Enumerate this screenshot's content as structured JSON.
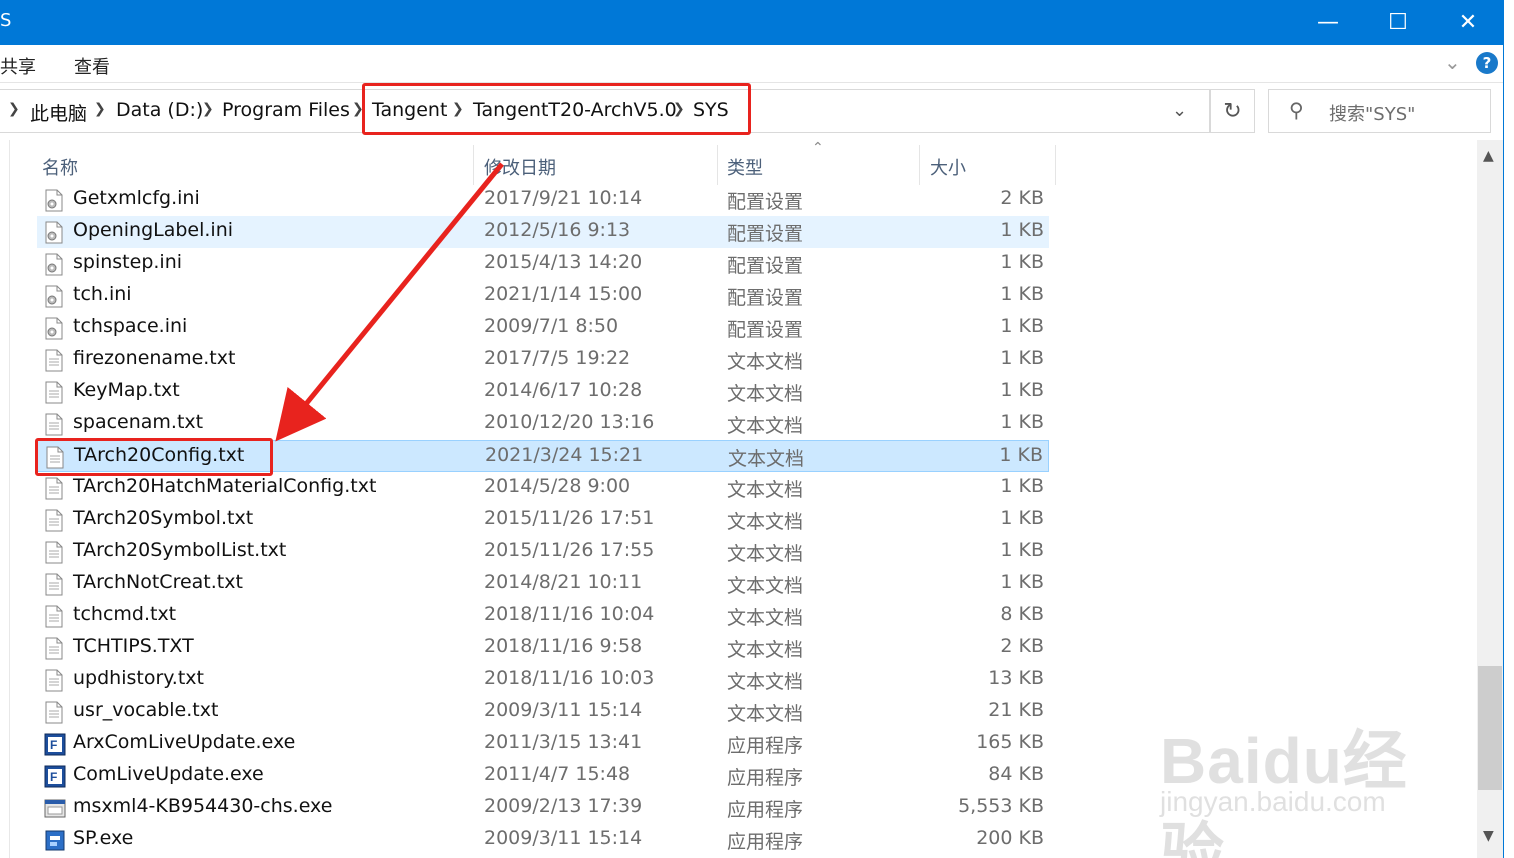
{
  "window": {
    "title_fragment": "S",
    "minimize_glyph": "—",
    "maximize_glyph": "☐",
    "close_glyph": "✕"
  },
  "ribbon": {
    "tabs": [
      "共享",
      "查看"
    ],
    "help_glyph": "?"
  },
  "address": {
    "crumbs": [
      "此电脑",
      "Data (D:)",
      "Program Files",
      "Tangent",
      "TangentT20-ArchV5.0",
      "SYS"
    ],
    "search_placeholder": "搜索\"SYS\""
  },
  "columns": [
    "名称",
    "修改日期",
    "类型",
    "大小"
  ],
  "files": [
    {
      "name": "Getxmlcfg.ini",
      "date": "2017/9/21 10:14",
      "type": "配置设置",
      "size": "2 KB",
      "icon": "ini-file-icon"
    },
    {
      "name": "OpeningLabel.ini",
      "date": "2012/5/16 9:13",
      "type": "配置设置",
      "size": "1 KB",
      "icon": "ini-file-icon"
    },
    {
      "name": "spinstep.ini",
      "date": "2015/4/13 14:20",
      "type": "配置设置",
      "size": "1 KB",
      "icon": "ini-file-icon"
    },
    {
      "name": "tch.ini",
      "date": "2021/1/14 15:00",
      "type": "配置设置",
      "size": "1 KB",
      "icon": "ini-file-icon"
    },
    {
      "name": "tchspace.ini",
      "date": "2009/7/1 8:50",
      "type": "配置设置",
      "size": "1 KB",
      "icon": "ini-file-icon"
    },
    {
      "name": "firezonename.txt",
      "date": "2017/7/5 19:22",
      "type": "文本文档",
      "size": "1 KB",
      "icon": "txt-file-icon"
    },
    {
      "name": "KeyMap.txt",
      "date": "2014/6/17 10:28",
      "type": "文本文档",
      "size": "1 KB",
      "icon": "txt-file-icon"
    },
    {
      "name": "spacenam.txt",
      "date": "2010/12/20 13:16",
      "type": "文本文档",
      "size": "1 KB",
      "icon": "txt-file-icon"
    },
    {
      "name": "TArch20Config.txt",
      "date": "2021/3/24 15:21",
      "type": "文本文档",
      "size": "1 KB",
      "icon": "txt-file-icon"
    },
    {
      "name": "TArch20HatchMaterialConfig.txt",
      "date": "2014/5/28 9:00",
      "type": "文本文档",
      "size": "1 KB",
      "icon": "txt-file-icon"
    },
    {
      "name": "TArch20Symbol.txt",
      "date": "2015/11/26 17:51",
      "type": "文本文档",
      "size": "1 KB",
      "icon": "txt-file-icon"
    },
    {
      "name": "TArch20SymbolList.txt",
      "date": "2015/11/26 17:55",
      "type": "文本文档",
      "size": "1 KB",
      "icon": "txt-file-icon"
    },
    {
      "name": "TArchNotCreat.txt",
      "date": "2014/8/21 10:11",
      "type": "文本文档",
      "size": "1 KB",
      "icon": "txt-file-icon"
    },
    {
      "name": "tchcmd.txt",
      "date": "2018/11/16 10:04",
      "type": "文本文档",
      "size": "8 KB",
      "icon": "txt-file-icon"
    },
    {
      "name": "TCHTIPS.TXT",
      "date": "2018/11/16 9:58",
      "type": "文本文档",
      "size": "2 KB",
      "icon": "txt-file-icon"
    },
    {
      "name": "updhistory.txt",
      "date": "2018/11/16 10:03",
      "type": "文本文档",
      "size": "13 KB",
      "icon": "txt-file-icon"
    },
    {
      "name": "usr_vocable.txt",
      "date": "2009/3/11 15:14",
      "type": "文本文档",
      "size": "21 KB",
      "icon": "txt-file-icon"
    },
    {
      "name": "ArxComLiveUpdate.exe",
      "date": "2011/3/15 13:41",
      "type": "应用程序",
      "size": "165 KB",
      "icon": "app-exe-icon"
    },
    {
      "name": "ComLiveUpdate.exe",
      "date": "2011/4/7 15:48",
      "type": "应用程序",
      "size": "84 KB",
      "icon": "app-exe-icon"
    },
    {
      "name": "msxml4-KB954430-chs.exe",
      "date": "2009/2/13 17:39",
      "type": "应用程序",
      "size": "5,553 KB",
      "icon": "installer-exe-icon"
    },
    {
      "name": "SP.exe",
      "date": "2009/3/11 15:14",
      "type": "应用程序",
      "size": "200 KB",
      "icon": "setup-exe-icon"
    }
  ],
  "hover_index": 1,
  "selected_index": 8,
  "colors": {
    "titlebar": "#0078d7",
    "highlight": "#e8231e",
    "selection": "#cce8ff",
    "hover": "#e5f3ff"
  },
  "watermark": {
    "main": "Baidu经验",
    "sub": "jingyan.baidu.com"
  }
}
